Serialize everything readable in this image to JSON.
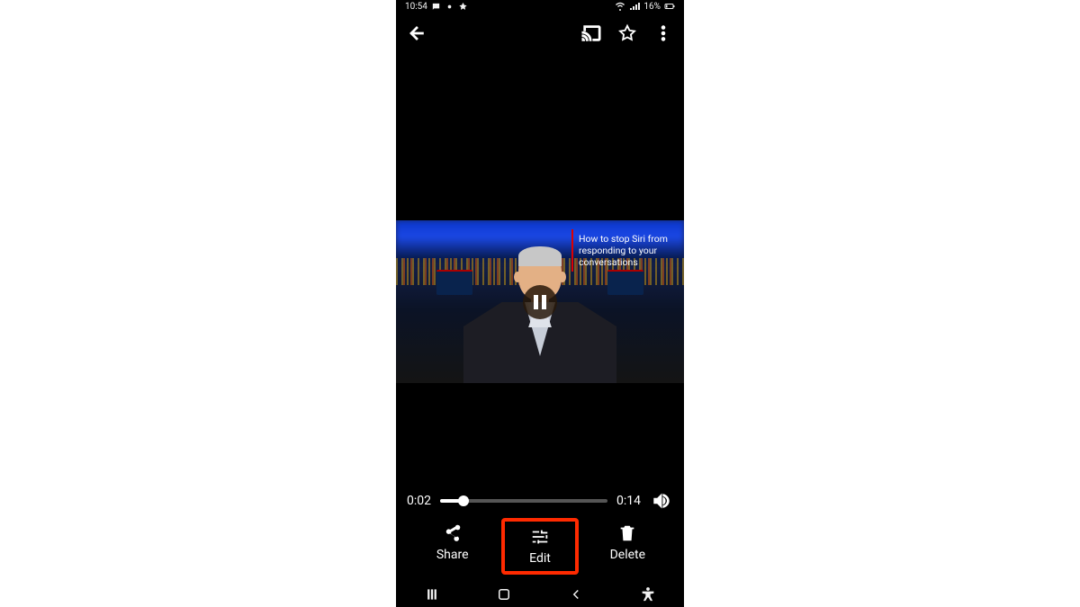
{
  "statusbar": {
    "time": "10:54",
    "battery": "16%"
  },
  "topbar": {
    "back_icon": "arrow-left",
    "cast_icon": "cast",
    "star_icon": "star-outline",
    "more_icon": "more-vertical"
  },
  "video": {
    "caption": "How to stop Siri from responding to your conversations"
  },
  "playback": {
    "current_time": "0:02",
    "duration": "0:14"
  },
  "actions": {
    "share_label": "Share",
    "edit_label": "Edit",
    "delete_label": "Delete"
  },
  "annotation": {
    "highlight": "edit"
  }
}
